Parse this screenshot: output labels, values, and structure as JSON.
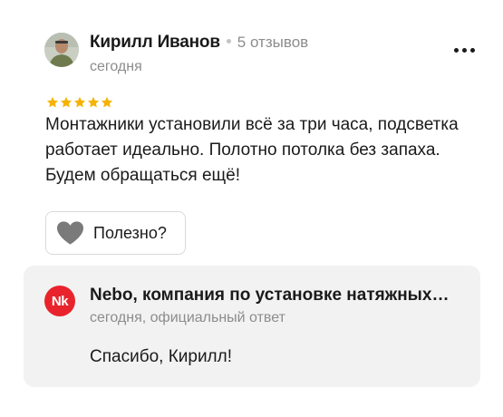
{
  "review": {
    "author_name": "Кирилл Иванов",
    "reviews_count": "5 отзывов",
    "date": "сегодня",
    "rating": 5,
    "rating_max": 5,
    "star_color": "#f5b301",
    "text": "Монтажники установили всё за три часа, подсветка работает идеально. Полотно потолка без запаха. Будем обращаться ещё!",
    "more_icon": "more-horizontal-icon",
    "helpful_label": "Полезно?",
    "helpful_icon": "heart-icon"
  },
  "reply": {
    "logo_text": "Nk",
    "logo_color": "#e8232c",
    "organization": "Nebo, компания по установке натяжных потолков",
    "meta": "сегодня, официальный ответ",
    "text": "Спасибо, Кирилл!"
  }
}
